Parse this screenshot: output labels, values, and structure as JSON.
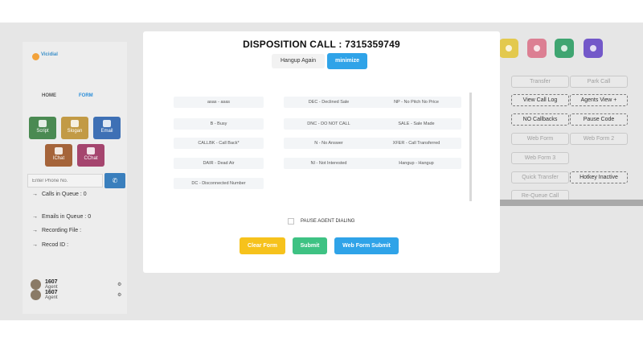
{
  "sidebar": {
    "logo_text": "Vicidial",
    "logo_sub": "",
    "tabs": [
      {
        "label": "HOME"
      },
      {
        "label": "FORM"
      }
    ],
    "tiles": [
      {
        "label": "Script",
        "color": "#4a8a52",
        "icon": "script-icon"
      },
      {
        "label": "Slogan",
        "color": "#c29a45",
        "icon": "slogan-icon"
      },
      {
        "label": "Email",
        "color": "#3e70b5",
        "icon": "email-icon"
      },
      {
        "label": "IChat",
        "color": "#a5643a",
        "icon": "chat-icon"
      },
      {
        "label": "CChat",
        "color": "#a5456e",
        "icon": "customer-chat-icon"
      }
    ],
    "phone_placeholder": "Enter Phone No.",
    "info": [
      {
        "label": "Calls in Queue : 0"
      },
      {
        "label": "Emails in Queue : 0"
      },
      {
        "label": "Recording File :"
      },
      {
        "label": "Recod ID :"
      }
    ],
    "agents": [
      {
        "name": "1607",
        "role": "Agent"
      },
      {
        "name": "1607",
        "role": "Agent"
      }
    ]
  },
  "right_panel": {
    "icons": [
      {
        "name": "settings-icon",
        "color": "#e3c94e"
      },
      {
        "name": "hangup-icon",
        "color": "#dc7f93"
      },
      {
        "name": "record-icon",
        "color": "#3fa571"
      },
      {
        "name": "phone-icon",
        "color": "#7358c9"
      }
    ],
    "buttons": [
      {
        "label": "Transfer"
      },
      {
        "label": "Park Call"
      },
      {
        "label": "View Call Log"
      },
      {
        "label": "Agents View +"
      },
      {
        "label": "NO Callbacks"
      },
      {
        "label": "Pause Code"
      },
      {
        "label": "Web Form"
      },
      {
        "label": "Web Form 2"
      },
      {
        "label": "Web Form 3"
      },
      {
        "label": "Quick Transfer"
      },
      {
        "label": "Hotkey Inactive"
      },
      {
        "label": "Re-Queue Call"
      }
    ]
  },
  "modal": {
    "title": "DISPOSITION CALL : 7315359749",
    "hangup_label": "Hangup Again",
    "minimize_label": "minimize",
    "dispositions": [
      {
        "label": "asas - asas"
      },
      {
        "label": "DEC - Declined Sale"
      },
      {
        "label": "NP - No Pitch No Price"
      },
      {
        "label": "B - Busy"
      },
      {
        "label": "DNC - DO NOT CALL"
      },
      {
        "label": "SALE - Sale Made"
      },
      {
        "label": "CALLBK - Call Back*"
      },
      {
        "label": "N - No Answer"
      },
      {
        "label": "XFER - Call Transferred"
      },
      {
        "label": "DAIR - Dead Air"
      },
      {
        "label": "NI - Not Interested"
      },
      {
        "label": "Hangup - Hangup"
      },
      {
        "label": "DC - Disconnected Number"
      }
    ],
    "pause_label": "PAUSE AGENT DIALING",
    "clear_label": "Clear Form",
    "submit_label": "Submit",
    "webform_label": "Web Form Submit"
  }
}
